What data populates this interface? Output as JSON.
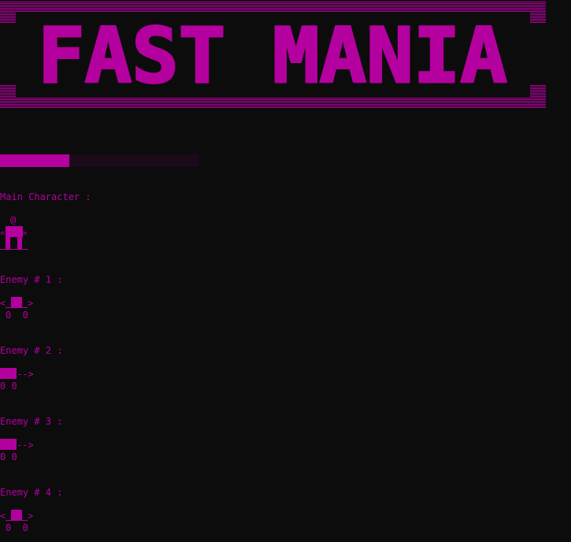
{
  "title": "FAST MANIA",
  "accent_color": "#b4009e",
  "background_color": "#0c0c0c",
  "load_progress": 0.35,
  "main_character": {
    "label": "Main Character :",
    "head_glyph": "@",
    "left_arm": "«",
    "right_arm": "»"
  },
  "enemies": [
    {
      "label": "Enemy # 1 :",
      "kind": "walker",
      "left": "<",
      "right": ">",
      "wheels": "0  0"
    },
    {
      "label": "Enemy # 2 :",
      "kind": "dasher",
      "arrow": "-->",
      "wheels": "0 0"
    },
    {
      "label": "Enemy # 3 :",
      "kind": "dasher",
      "arrow": "-->",
      "wheels": "0 0"
    },
    {
      "label": "Enemy # 4 :",
      "kind": "walker",
      "left": "<",
      "right": ">",
      "wheels": "0  0"
    }
  ]
}
